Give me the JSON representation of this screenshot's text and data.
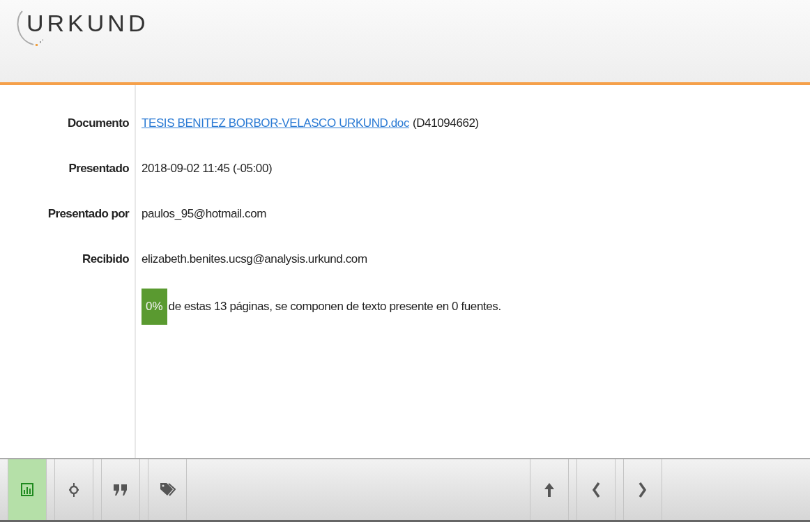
{
  "logo": {
    "text": "URKUND"
  },
  "details": [
    {
      "label": "Documento",
      "kind": "link",
      "link": "TESIS BENITEZ BORBOR-VELASCO URKUND.doc",
      "value": "(D41094662)"
    },
    {
      "label": "Presentado",
      "kind": "text",
      "value": "2018-09-02 11:45 (-05:00)"
    },
    {
      "label": "Presentado por",
      "kind": "text",
      "value": "paulos_95@hotmail.com"
    },
    {
      "label": "Recibido",
      "kind": "text",
      "value": "elizabeth.benites.ucsg@analysis.urkund.com"
    }
  ],
  "summary": {
    "percent": "0%",
    "text": "de estas 13 páginas, se componen de texto presente en 0 fuentes."
  },
  "toolbar": {
    "left": [
      {
        "kind": "chart",
        "selected": true
      },
      {
        "kind": "crosshair",
        "selected": false
      },
      {
        "kind": "quote",
        "selected": false
      },
      {
        "kind": "tag",
        "selected": false
      }
    ],
    "right": [
      {
        "kind": "up",
        "selected": false
      },
      {
        "kind": "prev",
        "selected": false
      },
      {
        "kind": "next",
        "selected": false
      }
    ]
  }
}
